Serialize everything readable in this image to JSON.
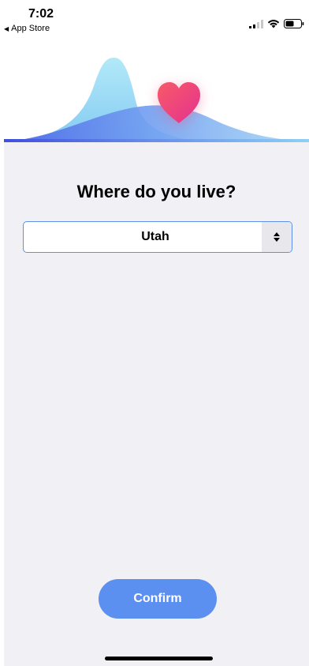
{
  "status_bar": {
    "time": "7:02",
    "back_label": "App Store"
  },
  "question": {
    "text": "Where do you live?"
  },
  "location_select": {
    "selected_value": "Utah"
  },
  "confirm_button": {
    "label": "Confirm"
  },
  "colors": {
    "accent": "#5b8ff0",
    "background": "#f1f0f5",
    "heart_start": "#f5507a",
    "heart_end": "#e8348c"
  }
}
